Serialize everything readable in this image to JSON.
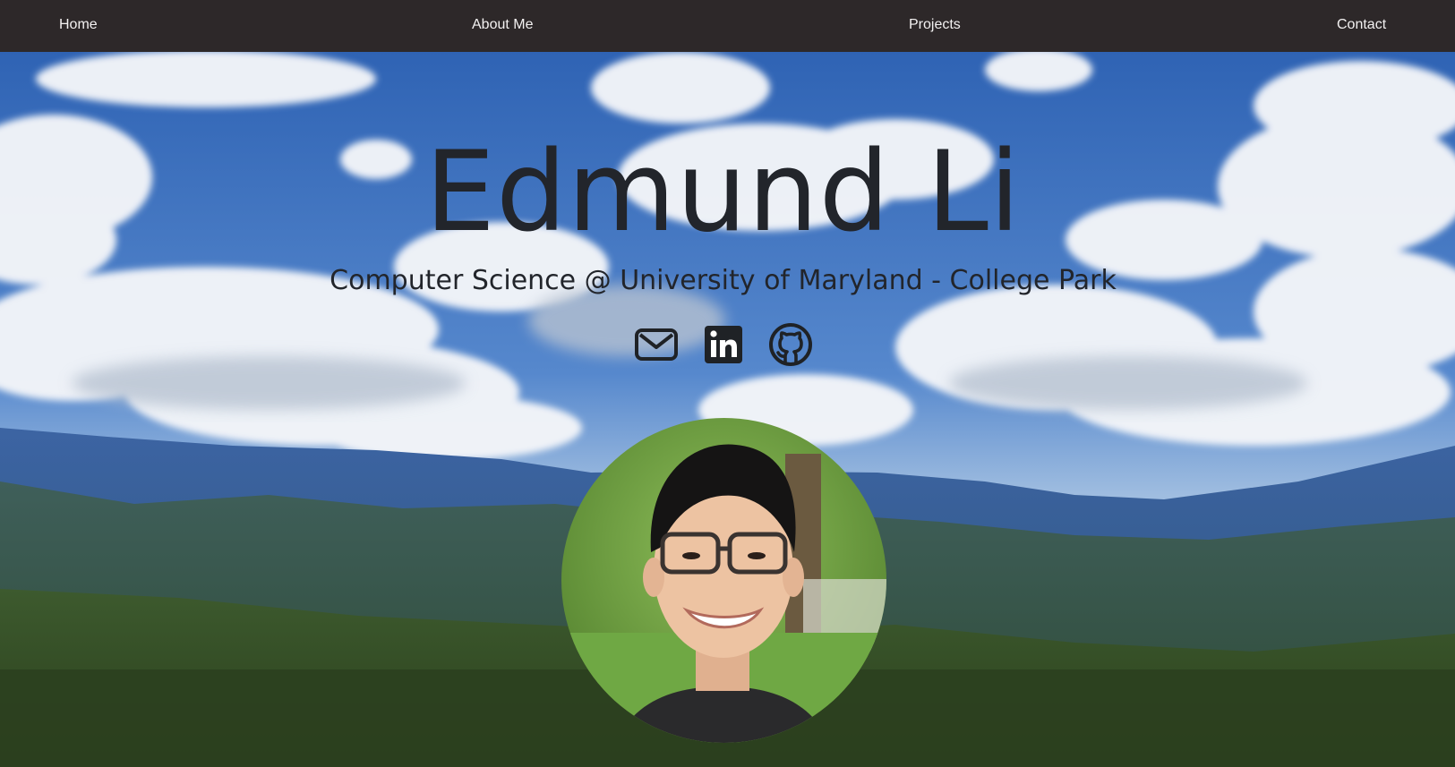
{
  "nav": {
    "home": "Home",
    "about": "About Me",
    "projects": "Projects",
    "contact": "Contact"
  },
  "hero": {
    "name": "Edmund Li",
    "subtitle": "Computer Science @ University of Maryland - College Park"
  },
  "social": [
    {
      "icon": "envelope-icon"
    },
    {
      "icon": "linkedin-icon"
    },
    {
      "icon": "github-icon"
    }
  ],
  "colors": {
    "navbar_bg": "#2d2829",
    "nav_text": "#f3f1f1",
    "hero_text": "#22252b"
  }
}
